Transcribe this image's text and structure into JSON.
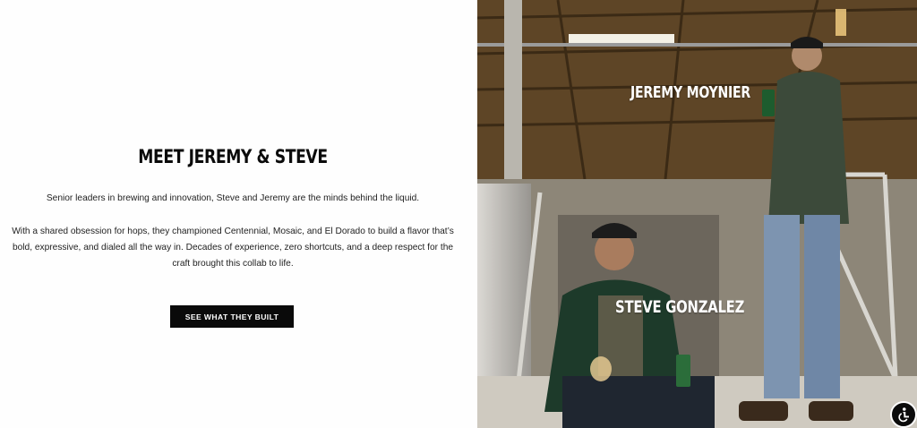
{
  "section": {
    "title": "MEET JEREMY & STEVE",
    "intro": "Senior leaders in brewing and innovation, Steve and Jeremy are the minds behind the liquid.",
    "body": "With a shared obsession for hops, they championed Centennial, Mosaic, and El Dorado to build a flavor that’s bold, expressive, and dialed all the way in. Decades of experience, zero shortcuts, and a deep respect for the craft brought this collab to life.",
    "cta_label": "SEE WHAT THEY BUILT"
  },
  "photo": {
    "label_top": "JEREMY MOYNIER",
    "label_bottom": "STEVE GONZALEZ"
  },
  "accessibility": {
    "icon": "accessibility-icon"
  },
  "colors": {
    "button_bg": "#0a0a0a",
    "button_text": "#ffffff",
    "heading": "#0b0b0b"
  }
}
